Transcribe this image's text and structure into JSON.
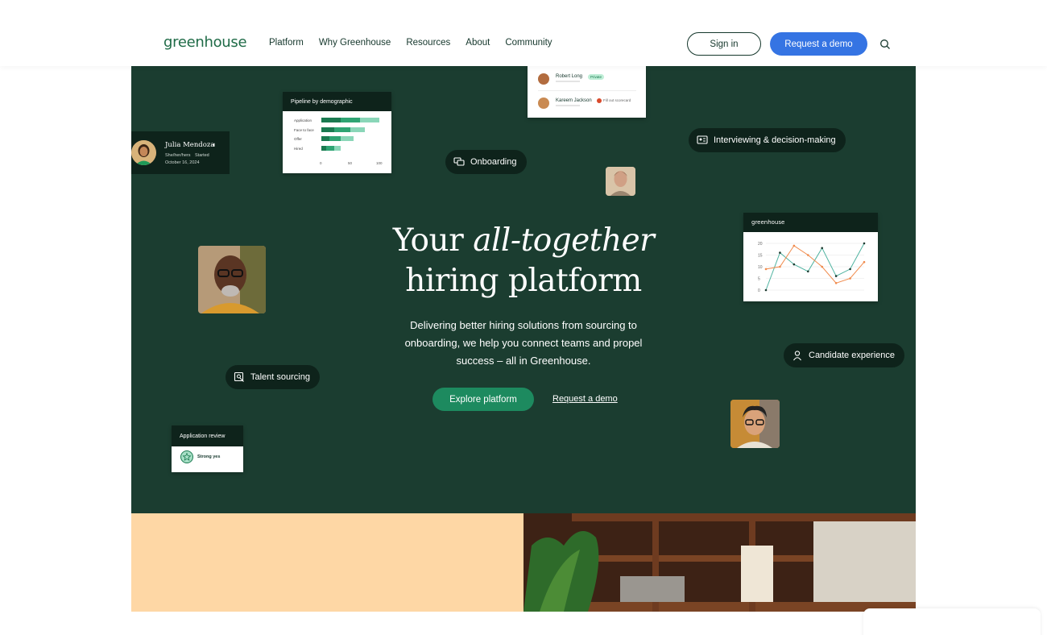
{
  "header": {
    "logo": "greenhouse",
    "nav": [
      "Platform",
      "Why Greenhouse",
      "Resources",
      "About",
      "Community"
    ],
    "signin_label": "Sign in",
    "demo_label": "Request a demo"
  },
  "hero": {
    "title_pre": "Your ",
    "title_em": "all-together",
    "title_line2": "hiring platform",
    "subtitle": "Delivering better hiring solutions from sourcing to onboarding, we help you connect teams and propel success – all in Greenhouse.",
    "explore_label": "Explore platform",
    "demo_link": "Request a demo"
  },
  "pills": {
    "onboarding": "Onboarding",
    "interviewing": "Interviewing & decision-making",
    "talent": "Talent sourcing",
    "candidate": "Candidate experience"
  },
  "profile_card": {
    "name": "Julia Mendoza",
    "pronouns": "She/her/hers",
    "started_label": "Started",
    "date": "October 16, 2024"
  },
  "pipeline_card": {
    "title": "Pipeline by demographic",
    "rows": [
      {
        "label": "Application",
        "segments": [
          24,
          24,
          24
        ]
      },
      {
        "label": "Face to face",
        "segments": [
          16,
          20,
          18
        ]
      },
      {
        "label": "Offer",
        "segments": [
          10,
          14,
          16
        ]
      },
      {
        "label": "Hired",
        "segments": [
          6,
          10,
          8
        ]
      }
    ],
    "axis": [
      "0",
      "50",
      "100"
    ],
    "colors": [
      "#1a7a50",
      "#2fa473",
      "#8ad6b8"
    ]
  },
  "candidates_card": {
    "rows": [
      {
        "name": "Robert Long",
        "badge": "Private",
        "status": ""
      },
      {
        "name": "Kareem Jackson",
        "badge": "",
        "status": "Fill out scorecard"
      }
    ]
  },
  "chart_card": {
    "header": "greenhouse",
    "chart_data": {
      "type": "line",
      "x": [
        1,
        2,
        3,
        4,
        5,
        6,
        7,
        8,
        9,
        10,
        11,
        12
      ],
      "series": [
        {
          "values": [
            0,
            16,
            11,
            8,
            18,
            6,
            9,
            20
          ],
          "color": "#4fb3a0"
        },
        {
          "values": [
            9,
            10,
            19,
            15,
            10,
            3,
            5,
            12
          ],
          "color": "#f08a4b"
        }
      ],
      "yticks": [
        "20",
        "15",
        "10",
        "5",
        "0"
      ],
      "ylim": [
        0,
        20
      ]
    }
  },
  "review_card": {
    "title": "Application review",
    "verdict": "Strong yes"
  }
}
